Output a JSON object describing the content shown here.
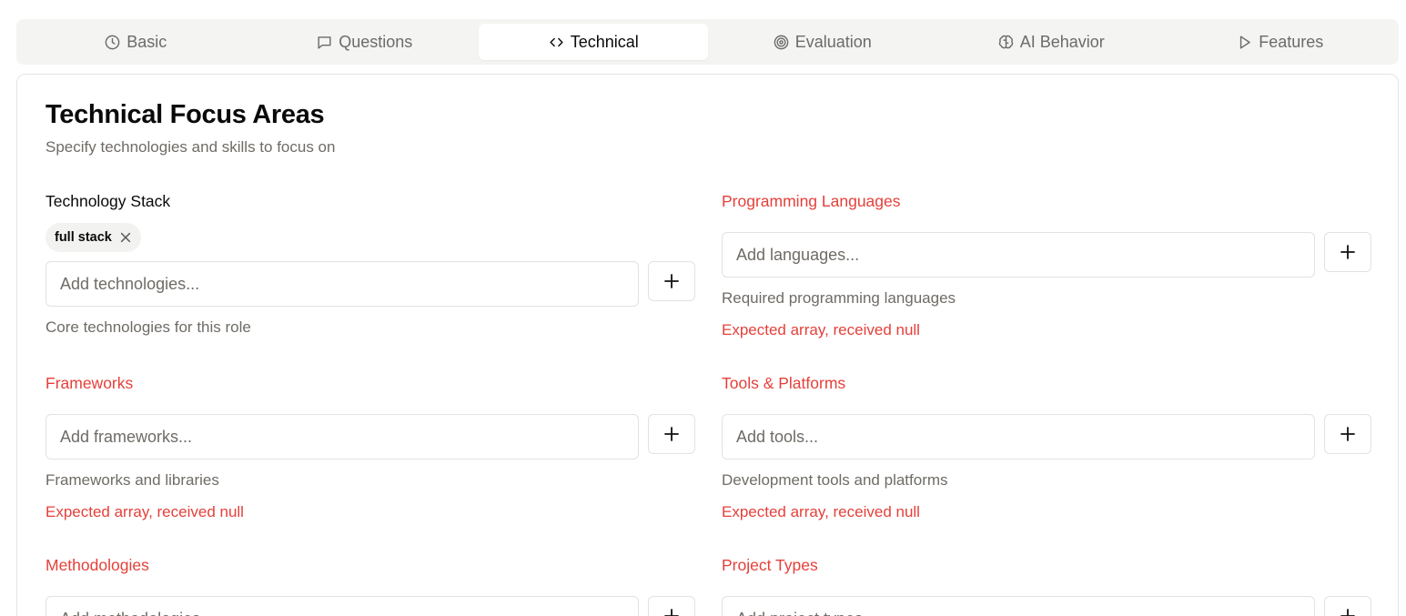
{
  "tabs": [
    {
      "label": "Basic",
      "icon": "clock-icon"
    },
    {
      "label": "Questions",
      "icon": "message-icon"
    },
    {
      "label": "Technical",
      "icon": "code-icon",
      "active": true
    },
    {
      "label": "Evaluation",
      "icon": "target-icon"
    },
    {
      "label": "AI Behavior",
      "icon": "brain-icon"
    },
    {
      "label": "Features",
      "icon": "play-icon"
    }
  ],
  "card": {
    "title": "Technical Focus Areas",
    "description": "Specify technologies and skills to focus on"
  },
  "fields": {
    "technology_stack": {
      "label": "Technology Stack",
      "chips": [
        "full stack"
      ],
      "placeholder": "Add technologies...",
      "hint": "Core technologies for this role"
    },
    "programming_languages": {
      "label": "Programming Languages",
      "placeholder": "Add languages...",
      "hint": "Required programming languages",
      "error": "Expected array, received null"
    },
    "frameworks": {
      "label": "Frameworks",
      "placeholder": "Add frameworks...",
      "hint": "Frameworks and libraries",
      "error": "Expected array, received null"
    },
    "tools_platforms": {
      "label": "Tools & Platforms",
      "placeholder": "Add tools...",
      "hint": "Development tools and platforms",
      "error": "Expected array, received null"
    },
    "methodologies": {
      "label": "Methodologies",
      "placeholder": "Add methodologies..."
    },
    "project_types": {
      "label": "Project Types",
      "placeholder": "Add project types..."
    }
  },
  "colors": {
    "error": "#e5403a",
    "muted": "#6f6b66",
    "tabbar_bg": "#f4f4f2"
  }
}
